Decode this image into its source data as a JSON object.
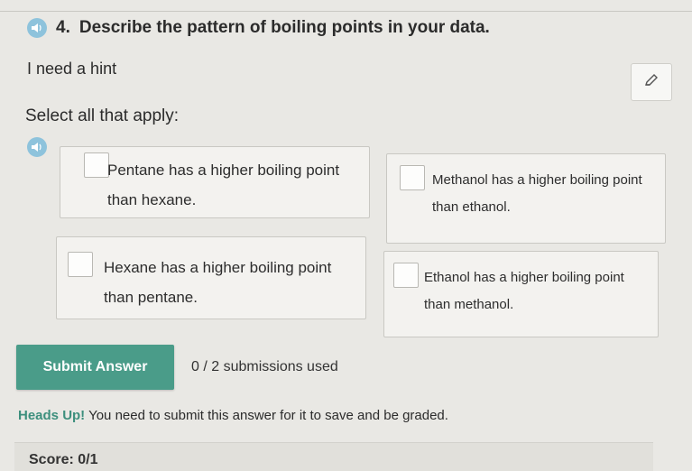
{
  "question": {
    "number": "4.",
    "text": "Describe the pattern of boiling points in your data.",
    "audio_icon": "speaker-icon"
  },
  "hint_link": "I need a hint",
  "edit_icon": "pencil-icon",
  "instructions": "Select all that apply:",
  "options": [
    {
      "label": "Pentane has a higher boiling point than hexane."
    },
    {
      "label": "Methanol has a higher boiling point than ethanol."
    },
    {
      "label": "Hexane has a higher boiling point than pentane."
    },
    {
      "label": "Ethanol has a higher boiling point than methanol."
    }
  ],
  "submit": {
    "label": "Submit Answer",
    "status": "0 / 2 submissions used"
  },
  "notice": {
    "strong": "Heads Up!",
    "text": " You need to submit this answer for it to save and be graded."
  },
  "score": {
    "label": "Score: 0/1"
  },
  "colors": {
    "submit_bg": "#4a9c89",
    "accent_text": "#3d8f7d",
    "audio_icon_bg": "#8ec3dc"
  }
}
